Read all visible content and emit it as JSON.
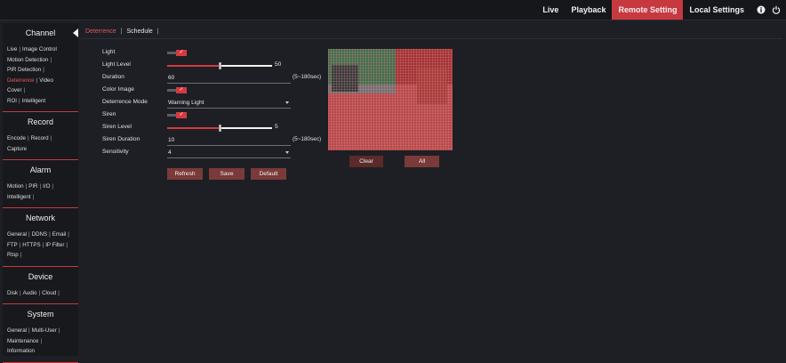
{
  "topnav": {
    "items": [
      {
        "label": "Live",
        "active": false
      },
      {
        "label": "Playback",
        "active": false
      },
      {
        "label": "Remote Setting",
        "active": true
      },
      {
        "label": "Local Settings",
        "active": false
      }
    ],
    "icons": [
      "info-icon",
      "power-icon"
    ],
    "accent": "#c8393f"
  },
  "sidebar": {
    "channel": {
      "title": "Channel",
      "lines": [
        [
          "Live",
          "Image Control"
        ],
        [
          "Motion Detection"
        ],
        [
          "PIR Detection"
        ],
        [
          "Deterrence",
          "Video Cover"
        ],
        [
          "ROI",
          "Intelligent"
        ]
      ]
    },
    "record": {
      "title": "Record",
      "lines": [
        [
          "Encode",
          "Record"
        ],
        [
          "Capture"
        ]
      ]
    },
    "alarm": {
      "title": "Alarm",
      "lines": [
        [
          "Motion",
          "PIR",
          "I/O"
        ],
        [
          "Intelligent"
        ]
      ]
    },
    "network": {
      "title": "Network",
      "lines": [
        [
          "General",
          "DDNS",
          "Email"
        ],
        [
          "FTP",
          "HTTPS",
          "IP Filter"
        ],
        [
          "Rtsp"
        ]
      ]
    },
    "device": {
      "title": "Device",
      "lines": [
        [
          "Disk",
          "Audio",
          "Cloud"
        ]
      ]
    },
    "system": {
      "title": "System",
      "lines": [
        [
          "General",
          "Multi-User"
        ],
        [
          "Maintenance"
        ],
        [
          "Information"
        ]
      ]
    },
    "selected_item": "Deterrence"
  },
  "tabs": {
    "deterrence": "Deterrence",
    "schedule": "Schedule",
    "sep": "|"
  },
  "form": {
    "light": {
      "label": "Light",
      "on": true
    },
    "light_level": {
      "label": "Light Level",
      "value": 50,
      "max": 100
    },
    "duration": {
      "label": "Duration",
      "value": "60",
      "unit": "(5~180sec)"
    },
    "color_image": {
      "label": "Color Image",
      "on": true
    },
    "deterrence_mode": {
      "label": "Deterrence Mode",
      "value": "Warning Light"
    },
    "siren": {
      "label": "Siren",
      "on": true
    },
    "siren_level": {
      "label": "Siren Level",
      "value": 5,
      "max": 10
    },
    "siren_duration": {
      "label": "Siren Duration",
      "value": "10",
      "unit": "(5~180sec)"
    },
    "sensitivity": {
      "label": "Sensitivity",
      "value": "4"
    },
    "check_mark": "✓"
  },
  "buttons": {
    "refresh": "Refresh",
    "save": "Save",
    "default": "Default",
    "clear": "Clear",
    "all": "All"
  }
}
